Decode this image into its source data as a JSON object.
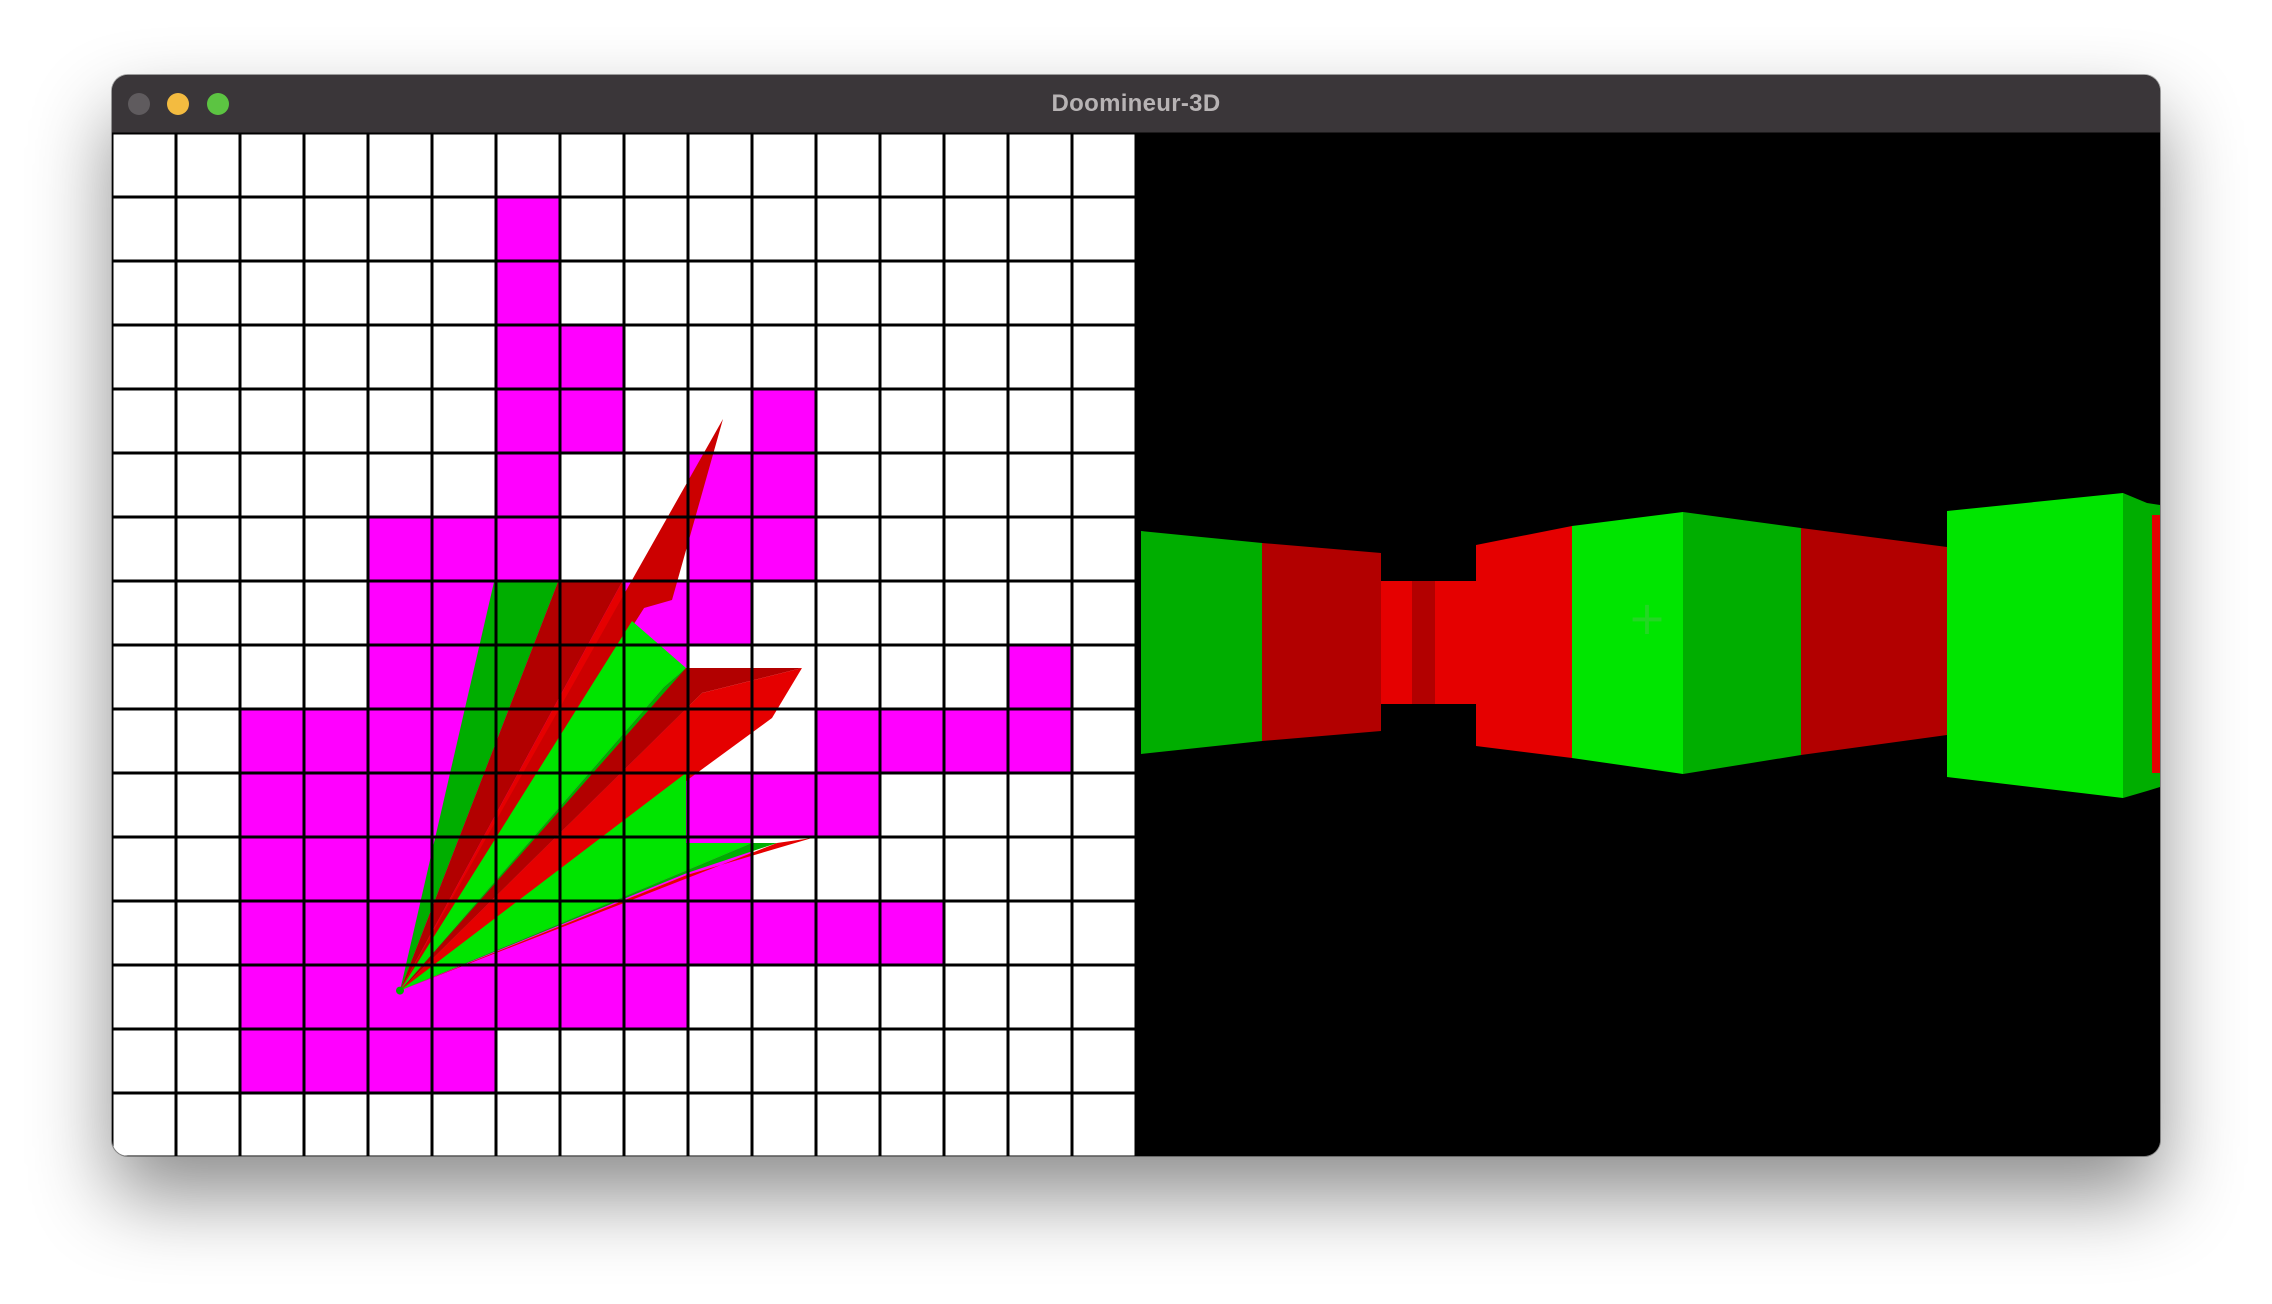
{
  "window": {
    "title": "Doomineur-3D",
    "controls": [
      "close",
      "minimize",
      "maximize"
    ]
  },
  "colors": {
    "titlebar": "#3a3639",
    "title_text": "#b7b3b4",
    "traffic_close": "#5f5b5e",
    "traffic_minimize": "#f3bb40",
    "traffic_maximize": "#5cc442",
    "map_floor": "#ffffff",
    "map_wall": "#ff00ff",
    "map_grid": "#000000",
    "view_background": "#000000",
    "wall_green": "#00e500",
    "wall_green_dark": "#00ae00",
    "wall_red": "#e50000",
    "wall_red_dark": "#b20000",
    "crosshair": "#2bd42b"
  },
  "map": {
    "columns": 16,
    "rows": 16,
    "wall_cells": [
      [
        6,
        1
      ],
      [
        6,
        2
      ],
      [
        6,
        3
      ],
      [
        7,
        3
      ],
      [
        6,
        4
      ],
      [
        7,
        4
      ],
      [
        10,
        4
      ],
      [
        6,
        5
      ],
      [
        9,
        5
      ],
      [
        10,
        5
      ],
      [
        4,
        6
      ],
      [
        5,
        6
      ],
      [
        6,
        6
      ],
      [
        9,
        6
      ],
      [
        10,
        6
      ],
      [
        4,
        7
      ],
      [
        5,
        7
      ],
      [
        6,
        7
      ],
      [
        7,
        7
      ],
      [
        8,
        7
      ],
      [
        9,
        7
      ],
      [
        4,
        8
      ],
      [
        5,
        8
      ],
      [
        6,
        8
      ],
      [
        7,
        8
      ],
      [
        8,
        8
      ],
      [
        14,
        8
      ],
      [
        2,
        9
      ],
      [
        3,
        9
      ],
      [
        4,
        9
      ],
      [
        5,
        9
      ],
      [
        6,
        9
      ],
      [
        7,
        9
      ],
      [
        8,
        9
      ],
      [
        11,
        9
      ],
      [
        12,
        9
      ],
      [
        13,
        9
      ],
      [
        14,
        9
      ],
      [
        2,
        10
      ],
      [
        3,
        10
      ],
      [
        4,
        10
      ],
      [
        5,
        10
      ],
      [
        6,
        10
      ],
      [
        7,
        10
      ],
      [
        8,
        10
      ],
      [
        9,
        10
      ],
      [
        10,
        10
      ],
      [
        11,
        10
      ],
      [
        2,
        11
      ],
      [
        3,
        11
      ],
      [
        4,
        11
      ],
      [
        5,
        11
      ],
      [
        6,
        11
      ],
      [
        7,
        11
      ],
      [
        8,
        11
      ],
      [
        9,
        11
      ],
      [
        2,
        12
      ],
      [
        3,
        12
      ],
      [
        4,
        12
      ],
      [
        5,
        12
      ],
      [
        6,
        12
      ],
      [
        7,
        12
      ],
      [
        8,
        12
      ],
      [
        9,
        12
      ],
      [
        10,
        12
      ],
      [
        11,
        12
      ],
      [
        12,
        12
      ],
      [
        2,
        13
      ],
      [
        3,
        13
      ],
      [
        4,
        13
      ],
      [
        5,
        13
      ],
      [
        6,
        13
      ],
      [
        7,
        13
      ],
      [
        8,
        13
      ],
      [
        2,
        14
      ],
      [
        3,
        14
      ],
      [
        4,
        14
      ],
      [
        5,
        14
      ]
    ],
    "player": {
      "x": 4.5,
      "y": 13.4
    }
  },
  "view": {
    "crosshair": "+"
  }
}
